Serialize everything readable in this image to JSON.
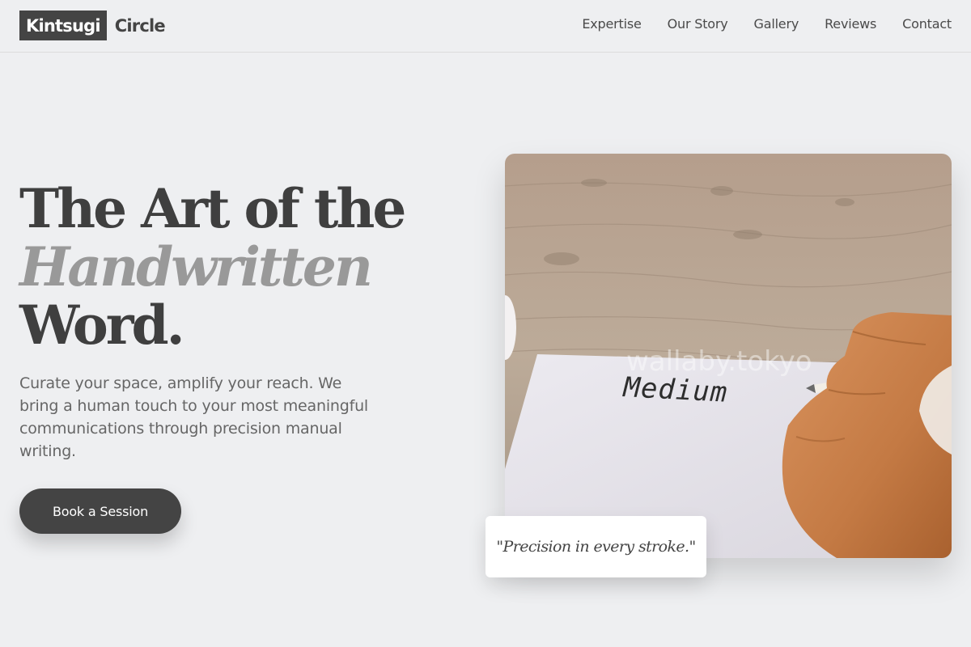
{
  "header": {
    "logo_box": "Kintsugi",
    "logo_text": "Circle",
    "nav": [
      "Expertise",
      "Our Story",
      "Gallery",
      "Reviews",
      "Contact"
    ]
  },
  "hero": {
    "title_line1": "The Art of the",
    "title_line2": "Handwritten",
    "title_line3": "Word.",
    "subtitle": "Curate your space, amplify your reach. We bring a human touch to your most meaningful communications through precision manual writing.",
    "cta_label": "Book a Session"
  },
  "photo": {
    "paper_text": "Medium",
    "watermark": "wallaby.tokyo"
  },
  "quote": "\"Precision in every stroke.\"",
  "colors": {
    "background": "#eeeff1",
    "primary": "#444444",
    "accent_muted": "#999999"
  }
}
